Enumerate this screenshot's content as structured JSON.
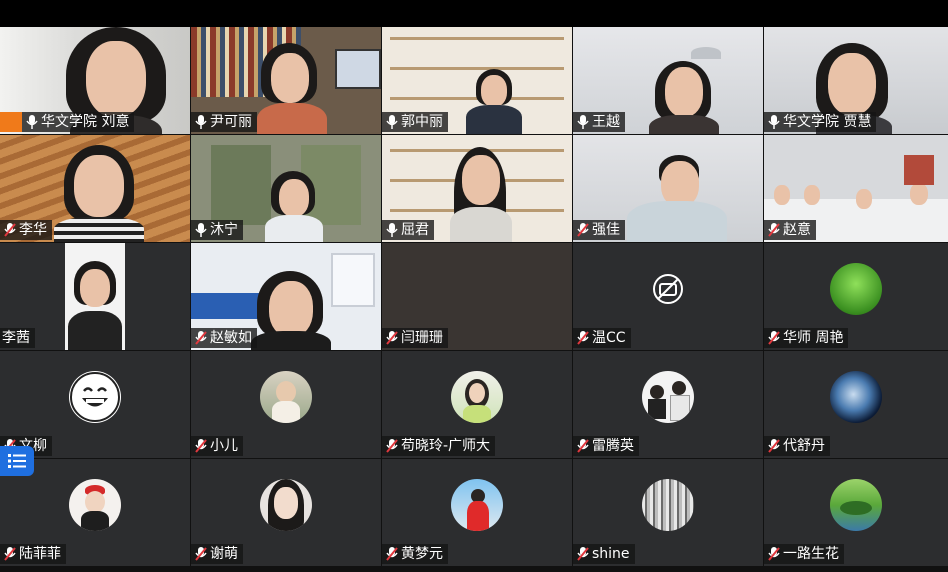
{
  "participants": [
    {
      "name": "华文学院 刘意",
      "mic": "on",
      "video": true,
      "host": true
    },
    {
      "name": "尹可丽",
      "mic": "on",
      "video": true
    },
    {
      "name": "郭中丽",
      "mic": "on",
      "video": true,
      "active": true
    },
    {
      "name": "王越",
      "mic": "on",
      "video": true
    },
    {
      "name": "华文学院 贾慧",
      "mic": "on",
      "video": true
    },
    {
      "name": "李华",
      "mic": "muted",
      "video": true
    },
    {
      "name": "沐宁",
      "mic": "on",
      "video": true
    },
    {
      "name": "屈君",
      "mic": "on",
      "video": true
    },
    {
      "name": "强佳",
      "mic": "muted",
      "video": true
    },
    {
      "name": "赵意",
      "mic": "muted",
      "video": true
    },
    {
      "name": "李茜",
      "mic": "none",
      "video": true
    },
    {
      "name": "赵敏如",
      "mic": "muted",
      "video": true
    },
    {
      "name": "闫珊珊",
      "mic": "muted",
      "video": false
    },
    {
      "name": "温CC",
      "mic": "muted",
      "video": false,
      "avatar": "camera-off-icon"
    },
    {
      "name": "华师  周艳",
      "mic": "muted",
      "video": false,
      "avatar": "grass-avatar"
    },
    {
      "name": "文柳",
      "mic": "muted",
      "video": false,
      "avatar": "smiley-avatar"
    },
    {
      "name": "小儿",
      "mic": "muted",
      "video": false,
      "avatar": "photo-avatar"
    },
    {
      "name": "苟晓玲-广师大",
      "mic": "muted",
      "video": false,
      "avatar": "photo-avatar"
    },
    {
      "name": "雷腾英",
      "mic": "muted",
      "video": false,
      "avatar": "photo-avatar"
    },
    {
      "name": "代舒丹",
      "mic": "muted",
      "video": false,
      "avatar": "earth-avatar"
    },
    {
      "name": "陆菲菲",
      "mic": "muted",
      "video": false,
      "avatar": "photo-avatar"
    },
    {
      "name": "谢萌",
      "mic": "muted",
      "video": false,
      "avatar": "photo-avatar"
    },
    {
      "name": "黄梦元",
      "mic": "muted",
      "video": false,
      "avatar": "photo-avatar"
    },
    {
      "name": "shine",
      "mic": "muted",
      "video": false,
      "avatar": "forest-avatar"
    },
    {
      "name": "一路生花",
      "mic": "muted",
      "video": false,
      "avatar": "landscape-avatar"
    }
  ],
  "colors": {
    "active_border": "#2fb34a",
    "muted_mic": "#e0383e",
    "host_badge": "#f07a1a",
    "chat_button": "#1f6fe0"
  }
}
